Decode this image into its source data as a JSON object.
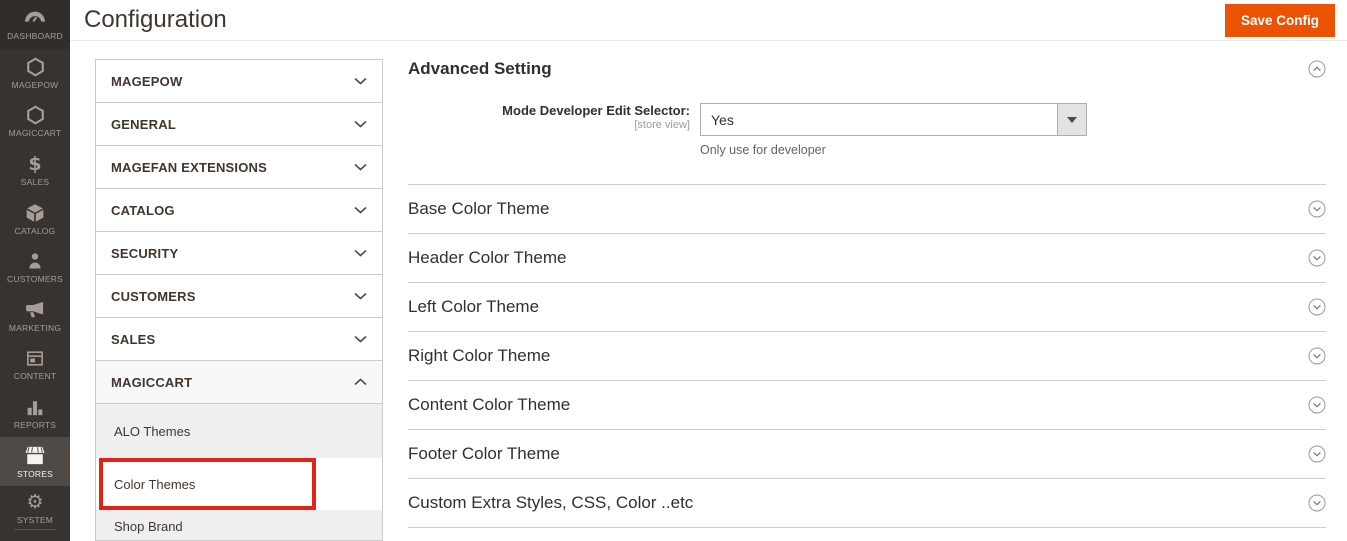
{
  "colors": {
    "accent_orange": "#eb5202",
    "sidebar_bg": "#373330",
    "annotation_red": "#e02417"
  },
  "header": {
    "title": "Configuration",
    "save_button": "Save Config"
  },
  "sidebar": {
    "items": [
      {
        "label": "DASHBOARD"
      },
      {
        "label": "MAGEPOW"
      },
      {
        "label": "MAGICCART"
      },
      {
        "label": "SALES"
      },
      {
        "label": "CATALOG"
      },
      {
        "label": "CUSTOMERS"
      },
      {
        "label": "MARKETING"
      },
      {
        "label": "CONTENT"
      },
      {
        "label": "REPORTS"
      },
      {
        "label": "STORES"
      },
      {
        "label": "SYSTEM"
      }
    ]
  },
  "config_nav": {
    "sections": [
      {
        "label": "MAGEPOW"
      },
      {
        "label": "GENERAL"
      },
      {
        "label": "MAGEFAN EXTENSIONS"
      },
      {
        "label": "CATALOG"
      },
      {
        "label": "SECURITY"
      },
      {
        "label": "CUSTOMERS"
      },
      {
        "label": "SALES"
      },
      {
        "label": "MAGICCART"
      }
    ],
    "magiccart_children": [
      {
        "label": "ALO Themes"
      },
      {
        "label": "Color Themes"
      },
      {
        "label": "Shop Brand"
      }
    ]
  },
  "main": {
    "advanced_section": {
      "title": "Advanced Setting",
      "field_label": "Mode Developer Edit Selector:",
      "field_scope": "[store view]",
      "field_value": "Yes",
      "field_note": "Only use for developer"
    },
    "collapsed_sections": [
      {
        "label": "Base Color Theme"
      },
      {
        "label": "Header Color Theme"
      },
      {
        "label": "Left Color Theme"
      },
      {
        "label": "Right Color Theme"
      },
      {
        "label": "Content Color Theme"
      },
      {
        "label": "Footer Color Theme"
      },
      {
        "label": "Custom Extra Styles, CSS, Color ..etc"
      }
    ]
  }
}
